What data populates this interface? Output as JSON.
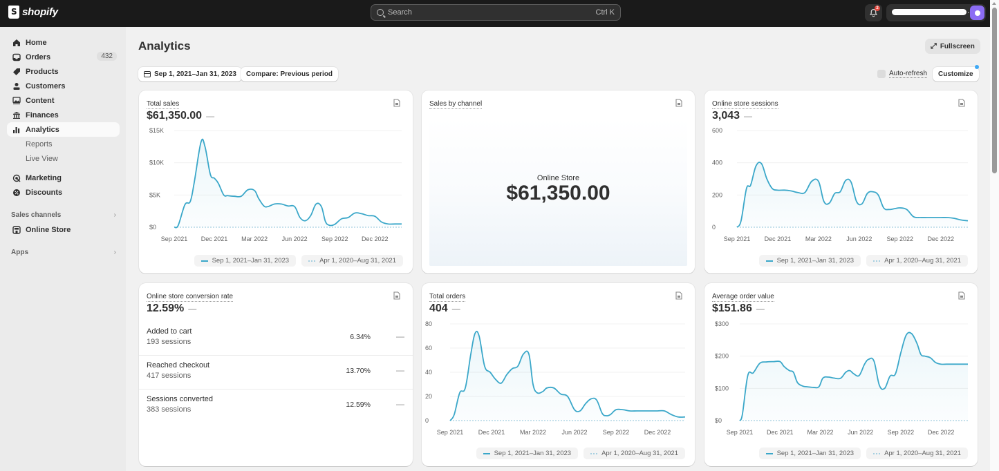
{
  "app": {
    "brand": "shopify",
    "search_placeholder": "Search",
    "search_shortcut": "Ctrl K",
    "notification_count": "2"
  },
  "sidebar": {
    "items": [
      {
        "label": "Home",
        "icon": "home-icon"
      },
      {
        "label": "Orders",
        "icon": "inbox-icon",
        "count": "432"
      },
      {
        "label": "Products",
        "icon": "tag-icon"
      },
      {
        "label": "Customers",
        "icon": "person-icon"
      },
      {
        "label": "Content",
        "icon": "image-icon"
      },
      {
        "label": "Finances",
        "icon": "bank-icon"
      },
      {
        "label": "Analytics",
        "icon": "bar-chart-icon",
        "active": true
      },
      {
        "label": "Marketing",
        "icon": "target-icon"
      },
      {
        "label": "Discounts",
        "icon": "discount-icon"
      }
    ],
    "analytics_sub": [
      "Reports",
      "Live View"
    ],
    "sales_channels_label": "Sales channels",
    "online_store_label": "Online Store",
    "apps_label": "Apps"
  },
  "page": {
    "title": "Analytics",
    "fullscreen_label": "Fullscreen",
    "date_range_label": "Sep 1, 2021–Jan 31, 2023",
    "compare_label": "Compare: Previous period",
    "auto_refresh_label": "Auto-refresh",
    "auto_refresh_checked": false,
    "customize_label": "Customize"
  },
  "legend": {
    "current": "Sep 1, 2021–Jan 31, 2023",
    "previous": "Apr 1, 2020–Aug 31, 2021"
  },
  "cards": {
    "total_sales": {
      "title": "Total sales",
      "value": "$61,350.00",
      "change": "—"
    },
    "sales_by_channel": {
      "title": "Sales by channel",
      "channel": "Online Store",
      "value": "$61,350.00"
    },
    "sessions": {
      "title": "Online store sessions",
      "value": "3,043",
      "change": "—"
    },
    "conversion": {
      "title": "Online store conversion rate",
      "value": "12.59%",
      "change": "—",
      "rows": [
        {
          "label": "Added to cart",
          "sessions": "193 sessions",
          "rate": "6.34%",
          "change": "—"
        },
        {
          "label": "Reached checkout",
          "sessions": "417 sessions",
          "rate": "13.70%",
          "change": "—"
        },
        {
          "label": "Sessions converted",
          "sessions": "383 sessions",
          "rate": "12.59%",
          "change": "—"
        }
      ]
    },
    "total_orders": {
      "title": "Total orders",
      "value": "404",
      "change": "—"
    },
    "aov": {
      "title": "Average order value",
      "value": "$151.86",
      "change": "—"
    }
  },
  "colors": {
    "line": "#3aa7c9",
    "previous_line": "#a5cfe0",
    "accent_avatar": "#8b6cf4",
    "notification": "#e5483f"
  },
  "chart_data": [
    {
      "id": "total_sales",
      "type": "area",
      "title": "Total sales",
      "x_unit": "months since Sep 1, 2021",
      "x_ticks": [
        "Sep 2021",
        "Dec 2021",
        "Mar 2022",
        "Jun 2022",
        "Sep 2022",
        "Dec 2022"
      ],
      "y_ticks": [
        "$0",
        "$5K",
        "$10K",
        "$15K"
      ],
      "ylim": [
        0,
        15000
      ],
      "xlim": [
        0,
        17
      ],
      "series": [
        {
          "name": "Sep 1, 2021–Jan 31, 2023",
          "x": [
            0,
            0.3,
            0.8,
            1.2,
            1.5,
            2.0,
            2.3,
            2.7,
            3.0,
            3.3,
            3.7,
            4.0,
            4.5,
            5.0,
            5.5,
            6.0,
            6.3,
            6.7,
            7.0,
            7.5,
            8.0,
            8.5,
            9.0,
            9.4,
            9.8,
            10.2,
            10.6,
            11.0,
            11.3,
            11.6,
            12.0,
            12.5,
            13.0,
            13.5,
            14.0,
            14.5,
            15.0,
            15.5,
            16.0,
            16.5,
            17.0
          ],
          "values": [
            0,
            300,
            3500,
            4000,
            7000,
            13200,
            12500,
            8200,
            7600,
            6800,
            5000,
            4900,
            4800,
            4800,
            5800,
            5700,
            4500,
            3300,
            3200,
            3600,
            3600,
            3300,
            3200,
            1500,
            1000,
            1800,
            3600,
            3200,
            900,
            300,
            450,
            1300,
            1500,
            2200,
            2100,
            1800,
            1700,
            800,
            500,
            500,
            500
          ]
        },
        {
          "name": "Apr 1, 2020–Aug 31, 2021",
          "values": [
            0
          ],
          "style": "dotted"
        }
      ]
    },
    {
      "id": "sessions",
      "type": "area",
      "title": "Online store sessions",
      "x_ticks": [
        "Sep 2021",
        "Dec 2021",
        "Mar 2022",
        "Jun 2022",
        "Sep 2022",
        "Dec 2022"
      ],
      "y_ticks": [
        "0",
        "200",
        "400",
        "600"
      ],
      "ylim": [
        0,
        600
      ],
      "xlim": [
        0,
        17
      ],
      "series": [
        {
          "name": "Sep 1, 2021–Jan 31, 2023",
          "x": [
            0,
            0.3,
            0.7,
            1.0,
            1.4,
            1.8,
            2.2,
            2.6,
            3.0,
            3.5,
            4.0,
            4.5,
            5.0,
            5.5,
            6.0,
            6.4,
            6.8,
            7.2,
            7.6,
            8.0,
            8.4,
            8.8,
            9.2,
            9.6,
            10.0,
            10.4,
            10.8,
            11.2,
            11.6,
            12.0,
            12.5,
            13.0,
            13.5,
            14.0,
            14.5,
            15.0,
            15.5,
            16.0,
            16.5,
            17.0
          ],
          "values": [
            0,
            40,
            240,
            260,
            380,
            395,
            300,
            240,
            230,
            230,
            225,
            215,
            215,
            285,
            285,
            160,
            150,
            210,
            220,
            290,
            280,
            160,
            145,
            210,
            220,
            200,
            120,
            110,
            115,
            120,
            110,
            65,
            60,
            60,
            60,
            60,
            60,
            55,
            45,
            40
          ]
        },
        {
          "name": "Apr 1, 2020–Aug 31, 2021",
          "values": [
            0
          ],
          "style": "dotted"
        }
      ]
    },
    {
      "id": "total_orders",
      "type": "area",
      "title": "Total orders",
      "x_ticks": [
        "Sep 2021",
        "Dec 2021",
        "Mar 2022",
        "Jun 2022",
        "Sep 2022",
        "Dec 2022"
      ],
      "y_ticks": [
        "0",
        "20",
        "40",
        "60",
        "80"
      ],
      "ylim": [
        0,
        80
      ],
      "xlim": [
        0,
        17
      ],
      "series": [
        {
          "name": "Sep 1, 2021–Jan 31, 2023",
          "x": [
            0,
            0.3,
            0.7,
            1.1,
            1.5,
            1.8,
            2.1,
            2.5,
            2.9,
            3.3,
            3.7,
            4.1,
            4.5,
            4.9,
            5.3,
            5.7,
            6.0,
            6.3,
            6.7,
            7.0,
            7.5,
            8.0,
            8.5,
            9.0,
            9.4,
            9.8,
            10.2,
            10.6,
            11.0,
            11.3,
            11.6,
            12.0,
            12.5,
            13.0,
            13.5,
            14.0,
            14.5,
            15.0,
            15.5,
            16.0,
            16.5,
            17.0
          ],
          "values": [
            0,
            5,
            23,
            27,
            55,
            72,
            70,
            45,
            40,
            34,
            31,
            38,
            43,
            45,
            55,
            55,
            30,
            23,
            24,
            27,
            27,
            22,
            20,
            9,
            8,
            14,
            18,
            17,
            6,
            4,
            5,
            9,
            9,
            8,
            8,
            8,
            8,
            8,
            8,
            5,
            3,
            3
          ]
        },
        {
          "name": "Apr 1, 2020–Aug 31, 2021",
          "values": [
            0
          ],
          "style": "dotted"
        }
      ]
    },
    {
      "id": "aov",
      "type": "area",
      "title": "Average order value",
      "x_ticks": [
        "Sep 2021",
        "Dec 2021",
        "Mar 2022",
        "Jun 2022",
        "Sep 2022",
        "Dec 2022"
      ],
      "y_ticks": [
        "$0",
        "$100",
        "$200",
        "$300"
      ],
      "ylim": [
        0,
        300
      ],
      "xlim": [
        0,
        17
      ],
      "series": [
        {
          "name": "Sep 1, 2021–Jan 31, 2023",
          "x": [
            0,
            0.2,
            0.6,
            1.0,
            1.5,
            2.0,
            2.5,
            3.0,
            3.3,
            3.7,
            4.0,
            4.3,
            4.7,
            5.0,
            5.5,
            5.9,
            6.2,
            6.6,
            7.0,
            7.5,
            7.9,
            8.2,
            8.5,
            8.9,
            9.3,
            9.6,
            10.0,
            10.4,
            10.8,
            11.2,
            11.6,
            12.0,
            12.4,
            12.8,
            13.2,
            13.5,
            13.8,
            14.2,
            14.6,
            15.0,
            15.4,
            15.8,
            16.2,
            16.6,
            17.0
          ],
          "values": [
            0,
            20,
            140,
            148,
            178,
            182,
            183,
            183,
            168,
            155,
            150,
            118,
            107,
            105,
            103,
            105,
            132,
            135,
            132,
            131,
            150,
            155,
            145,
            140,
            175,
            190,
            185,
            110,
            100,
            138,
            145,
            210,
            265,
            270,
            240,
            205,
            200,
            195,
            180,
            175,
            175,
            175,
            175,
            175,
            175
          ]
        },
        {
          "name": "Apr 1, 2020–Aug 31, 2021",
          "values": [
            0
          ],
          "style": "dotted"
        }
      ]
    }
  ]
}
